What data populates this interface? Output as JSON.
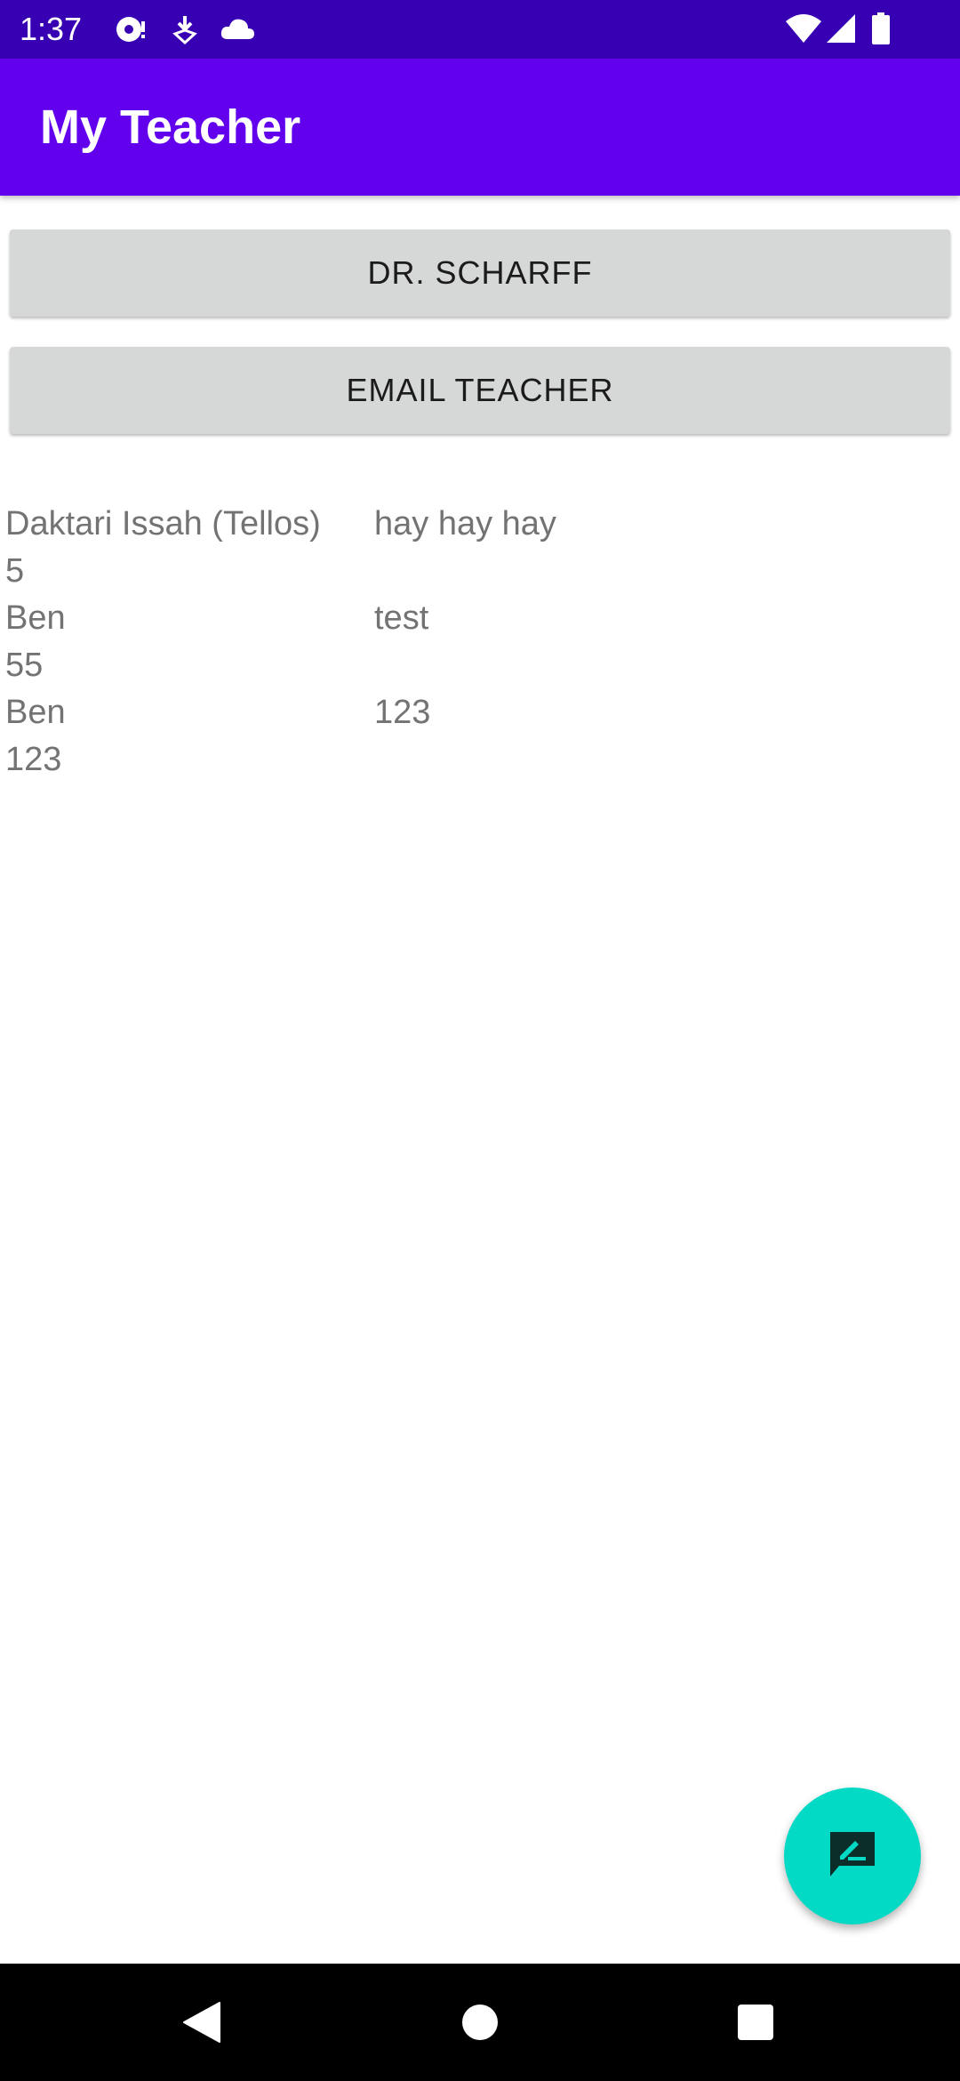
{
  "status_bar": {
    "time": "1:37",
    "left_icons": [
      "settings-icon",
      "download-notification-icon",
      "cloud-icon"
    ],
    "right_icons": [
      "wifi-icon",
      "cellular-signal-icon",
      "battery-icon"
    ]
  },
  "app_bar": {
    "title": "My Teacher"
  },
  "buttons": {
    "teacher_label": "DR. SCHARFF",
    "email_label": "EMAIL TEACHER"
  },
  "reviews": [
    {
      "name": "Daktari Issah (Tellos)",
      "rating": "5",
      "comment": "hay hay hay"
    },
    {
      "name": "Ben",
      "rating": "55",
      "comment": "test"
    },
    {
      "name": "Ben",
      "rating": "123",
      "comment": "123"
    }
  ],
  "fab": {
    "icon": "rate-review-icon"
  },
  "colors": {
    "status_bar": "#3700b3",
    "primary": "#6200ee",
    "accent": "#03dac5",
    "button_bg": "#d6d7d7"
  }
}
